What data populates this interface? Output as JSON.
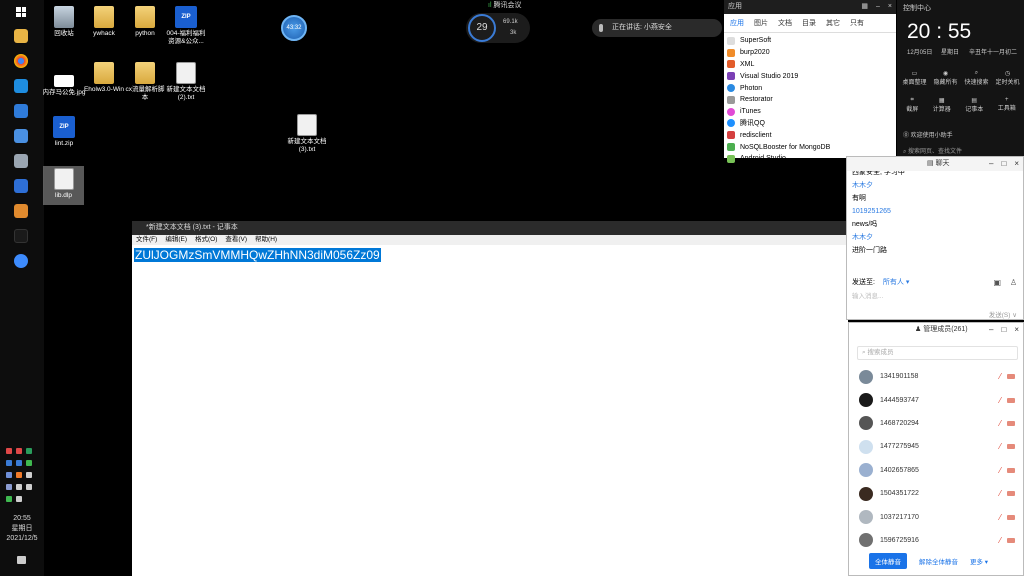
{
  "desktop": {
    "icons": [
      {
        "label": "回收站"
      },
      {
        "label": "ywhack"
      },
      {
        "label": "python"
      },
      {
        "label": "004-福利福利资源&公众..."
      },
      {
        "label": "内存马公免.jpg"
      },
      {
        "label": "Eholw3.0-Win"
      },
      {
        "label": "cx流量解析脚本"
      },
      {
        "label": "新建文本文档 (2).txt"
      },
      {
        "label": "lint.zip"
      },
      {
        "label": "新建文本文档 (3).txt"
      },
      {
        "label": "lib.dlp"
      }
    ],
    "zip_badge": "ZIP",
    "float_ball_text": "43:32",
    "temp": "29",
    "net_up": "69.1k",
    "net_down": "3k",
    "meeting_label": "腾讯会议",
    "speaking_label": "正在讲话: 小燕安全"
  },
  "left_clock": {
    "time": "20:55",
    "weekday": "星期日",
    "date": "2021/12/5"
  },
  "notepad": {
    "title": "*新建文本文档 (3).txt - 记事本",
    "menu": [
      "文件(F)",
      "编辑(E)",
      "格式(O)",
      "查看(V)",
      "帮助(H)"
    ],
    "content": "ZUlJOGMzSmVMMHQwZHhNN3diM056Zz09"
  },
  "app_list": {
    "header": "应用",
    "tabs": [
      "应用",
      "图片",
      "文档",
      "目录",
      "其它",
      "只有"
    ],
    "items": [
      "SuperSoft",
      "burp2020",
      "XML",
      "Visual Studio 2019",
      "Photon",
      "Restorator",
      "iTunes",
      "腾讯QQ",
      "redisclient",
      "NoSQLBooster for MongoDB",
      "Android Studio"
    ]
  },
  "control_center": {
    "title": "控制中心",
    "time": "20 : 55",
    "date": "12月05日",
    "weekday": "星期日",
    "lunar": "辛丑年十一月初二",
    "row1": [
      "桌面整理",
      "隐藏所有",
      "快速搜索",
      "定时关机"
    ],
    "row2": [
      "截屏",
      "计算器",
      "记事本",
      "工具箱"
    ],
    "bottom_label": "欢迎使用小助手",
    "search_placeholder": "搜索网页、查找文件"
  },
  "chat": {
    "title": "聊天",
    "lines": [
      {
        "text": "西蒙安全, 学习中",
        "color": "#000"
      },
      {
        "text": "木木夕",
        "color": "#2a7ae2"
      },
      {
        "text": "有啊",
        "color": "#000"
      },
      {
        "text": "1019251265",
        "color": "#2a7ae2"
      },
      {
        "text": "news/吗",
        "color": "#000"
      },
      {
        "text": "木木夕",
        "color": "#2a7ae2"
      },
      {
        "text": "进阶一门路",
        "color": "#000"
      }
    ],
    "send_to_label": "发送至:",
    "send_to_value": "所有人",
    "input_placeholder": "输入消息...",
    "send_button": "发送(S)"
  },
  "members": {
    "title": "管理成员(261)",
    "search_placeholder": "搜索成员",
    "list": [
      {
        "name": "1341901158",
        "avatar": "#7a8a99"
      },
      {
        "name": "1444593747",
        "avatar": "#1a1a1a"
      },
      {
        "name": "1468720294",
        "avatar": "#555555"
      },
      {
        "name": "1477275945",
        "avatar": "#cfe0ef"
      },
      {
        "name": "1402657865",
        "avatar": "#9ab0d0"
      },
      {
        "name": "1504351722",
        "avatar": "#3a2a20"
      },
      {
        "name": "1037217170",
        "avatar": "#b0b8c0"
      },
      {
        "name": "1596725916",
        "avatar": "#707070"
      }
    ],
    "btn_mute_all": "全体静音",
    "btn_unmute_all": "解除全体静音",
    "btn_more": "更多"
  }
}
